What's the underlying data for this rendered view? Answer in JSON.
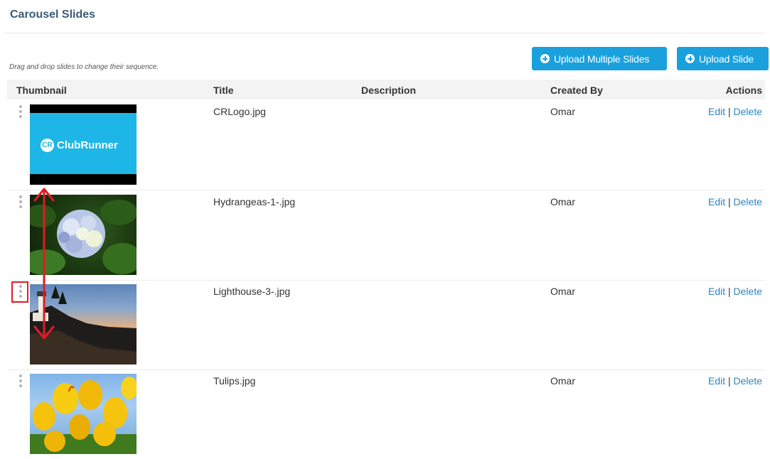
{
  "page": {
    "title": "Carousel Slides",
    "hint": "Drag and drop slides to change their sequence."
  },
  "buttons": {
    "upload_multiple": "Upload Multiple Slides",
    "upload_single": "Upload Slide"
  },
  "table": {
    "columns": {
      "thumbnail": "Thumbnail",
      "title": "Title",
      "description": "Description",
      "created_by": "Created By",
      "actions": "Actions"
    },
    "rows": [
      {
        "title": "CRLogo.jpg",
        "description": "",
        "created_by": "Omar",
        "edit": "Edit",
        "delete": "Delete",
        "thumb_text": "ClubRunner",
        "thumb_badge": "CR"
      },
      {
        "title": "Hydrangeas-1-.jpg",
        "description": "",
        "created_by": "Omar",
        "edit": "Edit",
        "delete": "Delete"
      },
      {
        "title": "Lighthouse-3-.jpg",
        "description": "",
        "created_by": "Omar",
        "edit": "Edit",
        "delete": "Delete"
      },
      {
        "title": "Tulips.jpg",
        "description": "",
        "created_by": "Omar",
        "edit": "Edit",
        "delete": "Delete"
      }
    ]
  },
  "colors": {
    "accent": "#1aa1dd",
    "heading": "#3a5a78",
    "link": "#2e86c1",
    "annotation": "#e01b24"
  }
}
